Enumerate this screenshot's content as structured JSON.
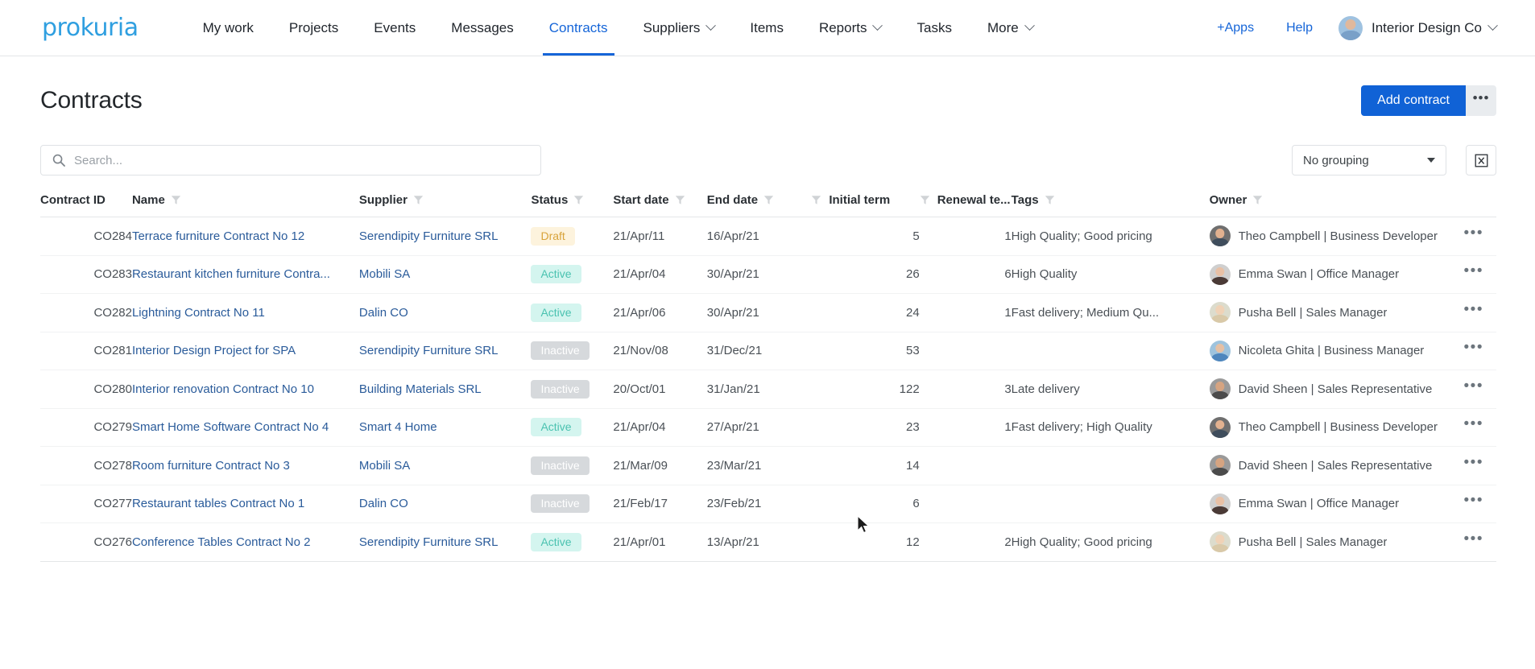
{
  "navbar": {
    "brand": "prokuria",
    "items": [
      {
        "label": "My work",
        "active": false,
        "caret": false
      },
      {
        "label": "Projects",
        "active": false,
        "caret": false
      },
      {
        "label": "Events",
        "active": false,
        "caret": false
      },
      {
        "label": "Messages",
        "active": false,
        "caret": false
      },
      {
        "label": "Contracts",
        "active": true,
        "caret": false
      },
      {
        "label": "Suppliers",
        "active": false,
        "caret": true
      },
      {
        "label": "Items",
        "active": false,
        "caret": false
      },
      {
        "label": "Reports",
        "active": false,
        "caret": true
      },
      {
        "label": "Tasks",
        "active": false,
        "caret": false
      },
      {
        "label": "More",
        "active": false,
        "caret": true
      }
    ],
    "apps_label": "+Apps",
    "help_label": "Help",
    "account_label": "Interior Design Co"
  },
  "header": {
    "title": "Contracts",
    "add_button": "Add contract",
    "more_button": "•••"
  },
  "toolbar": {
    "search_placeholder": "Search...",
    "search_value": "",
    "grouping_selected": "No grouping",
    "export_icon": "export-excel-icon"
  },
  "table": {
    "columns": [
      {
        "key": "contract_id",
        "label": "Contract ID",
        "filter": false,
        "align": "right"
      },
      {
        "key": "name",
        "label": "Name",
        "filter": true,
        "align": "left"
      },
      {
        "key": "supplier",
        "label": "Supplier",
        "filter": true,
        "align": "left"
      },
      {
        "key": "status",
        "label": "Status",
        "filter": true,
        "align": "left"
      },
      {
        "key": "start_date",
        "label": "Start date",
        "filter": true,
        "align": "left"
      },
      {
        "key": "end_date",
        "label": "End date",
        "filter": true,
        "align": "left"
      },
      {
        "key": "initial_term",
        "label": "Initial term",
        "filter": true,
        "align": "right"
      },
      {
        "key": "renewal_term",
        "label": "Renewal te...",
        "filter": true,
        "align": "right"
      },
      {
        "key": "tags",
        "label": "Tags",
        "filter": true,
        "align": "left"
      },
      {
        "key": "owner",
        "label": "Owner",
        "filter": true,
        "align": "left"
      }
    ],
    "rows": [
      {
        "contract_id": "CO284",
        "name": "Terrace furniture Contract No 12",
        "supplier": "Serendipity Furniture SRL",
        "status": "Draft",
        "status_kind": "draft",
        "start_date": "21/Apr/11",
        "end_date": "16/Apr/21",
        "initial_term": "5",
        "renewal_term": "1",
        "tags": "High Quality; Good pricing",
        "owner": "Theo Campbell | Business Developer",
        "avatar_skin": "#e2b18f",
        "avatar_shirt": "#3f4d5c",
        "avatar_bg": "#6f6f6f"
      },
      {
        "contract_id": "CO283",
        "name": "Restaurant kitchen furniture Contra...",
        "supplier": "Mobili SA",
        "status": "Active",
        "status_kind": "active",
        "start_date": "21/Apr/04",
        "end_date": "30/Apr/21",
        "initial_term": "26",
        "renewal_term": "6",
        "tags": "High Quality",
        "owner": "Emma Swan | Office Manager",
        "avatar_skin": "#e8c0a5",
        "avatar_shirt": "#4a3a36",
        "avatar_bg": "#cfcfcf"
      },
      {
        "contract_id": "CO282",
        "name": "Lightning Contract No 11",
        "supplier": "Dalin CO",
        "status": "Active",
        "status_kind": "active",
        "start_date": "21/Apr/06",
        "end_date": "30/Apr/21",
        "initial_term": "24",
        "renewal_term": "1",
        "tags": "Fast delivery; Medium Qu...",
        "owner": "Pusha Bell | Sales Manager",
        "avatar_skin": "#f0d2b6",
        "avatar_shirt": "#d9c9a8",
        "avatar_bg": "#dcdccd"
      },
      {
        "contract_id": "CO281",
        "name": "Interior Design Project for SPA",
        "supplier": "Serendipity Furniture SRL",
        "status": "Inactive",
        "status_kind": "inactive",
        "start_date": "21/Nov/08",
        "end_date": "31/Dec/21",
        "initial_term": "53",
        "renewal_term": "",
        "tags": "",
        "owner": "Nicoleta Ghita | Business Manager",
        "avatar_skin": "#e5c0a4",
        "avatar_shirt": "#4e86bd",
        "avatar_bg": "#9ec3dd"
      },
      {
        "contract_id": "CO280",
        "name": "Interior renovation Contract No 10",
        "supplier": "Building Materials SRL",
        "status": "Inactive",
        "status_kind": "inactive",
        "start_date": "20/Oct/01",
        "end_date": "31/Jan/21",
        "initial_term": "122",
        "renewal_term": "3",
        "tags": "Late delivery",
        "owner": "David Sheen | Sales Representative",
        "avatar_skin": "#d6a481",
        "avatar_shirt": "#4b4b4b",
        "avatar_bg": "#9a9a9a"
      },
      {
        "contract_id": "CO279",
        "name": "Smart Home Software Contract No 4",
        "supplier": "Smart 4 Home",
        "status": "Active",
        "status_kind": "active",
        "start_date": "21/Apr/04",
        "end_date": "27/Apr/21",
        "initial_term": "23",
        "renewal_term": "1",
        "tags": "Fast delivery; High Quality",
        "owner": "Theo Campbell | Business Developer",
        "avatar_skin": "#e2b18f",
        "avatar_shirt": "#3f4d5c",
        "avatar_bg": "#6f6f6f"
      },
      {
        "contract_id": "CO278",
        "name": "Room furniture Contract No 3",
        "supplier": "Mobili SA",
        "status": "Inactive",
        "status_kind": "inactive",
        "start_date": "21/Mar/09",
        "end_date": "23/Mar/21",
        "initial_term": "14",
        "renewal_term": "",
        "tags": "",
        "owner": "David Sheen | Sales Representative",
        "avatar_skin": "#d6a481",
        "avatar_shirt": "#4b4b4b",
        "avatar_bg": "#9a9a9a"
      },
      {
        "contract_id": "CO277",
        "name": "Restaurant tables Contract No 1",
        "supplier": "Dalin CO",
        "status": "Inactive",
        "status_kind": "inactive",
        "start_date": "21/Feb/17",
        "end_date": "23/Feb/21",
        "initial_term": "6",
        "renewal_term": "",
        "tags": "",
        "owner": "Emma Swan | Office Manager",
        "avatar_skin": "#e8c0a5",
        "avatar_shirt": "#4a3a36",
        "avatar_bg": "#cfcfcf"
      },
      {
        "contract_id": "CO276",
        "name": "Conference Tables Contract No 2",
        "supplier": "Serendipity Furniture SRL",
        "status": "Active",
        "status_kind": "active",
        "start_date": "21/Apr/01",
        "end_date": "13/Apr/21",
        "initial_term": "12",
        "renewal_term": "2",
        "tags": "High Quality; Good pricing",
        "owner": "Pusha Bell | Sales Manager",
        "avatar_skin": "#f0d2b6",
        "avatar_shirt": "#d9c9a8",
        "avatar_bg": "#dcdccd"
      }
    ],
    "row_menu_label": "•••"
  },
  "colors": {
    "brand": "#2f9fe0",
    "accent": "#1062d6",
    "link": "#2a5b9a",
    "draft": "#d8a33a",
    "active": "#4ac2b0",
    "inactive": "#d6d9dc"
  }
}
